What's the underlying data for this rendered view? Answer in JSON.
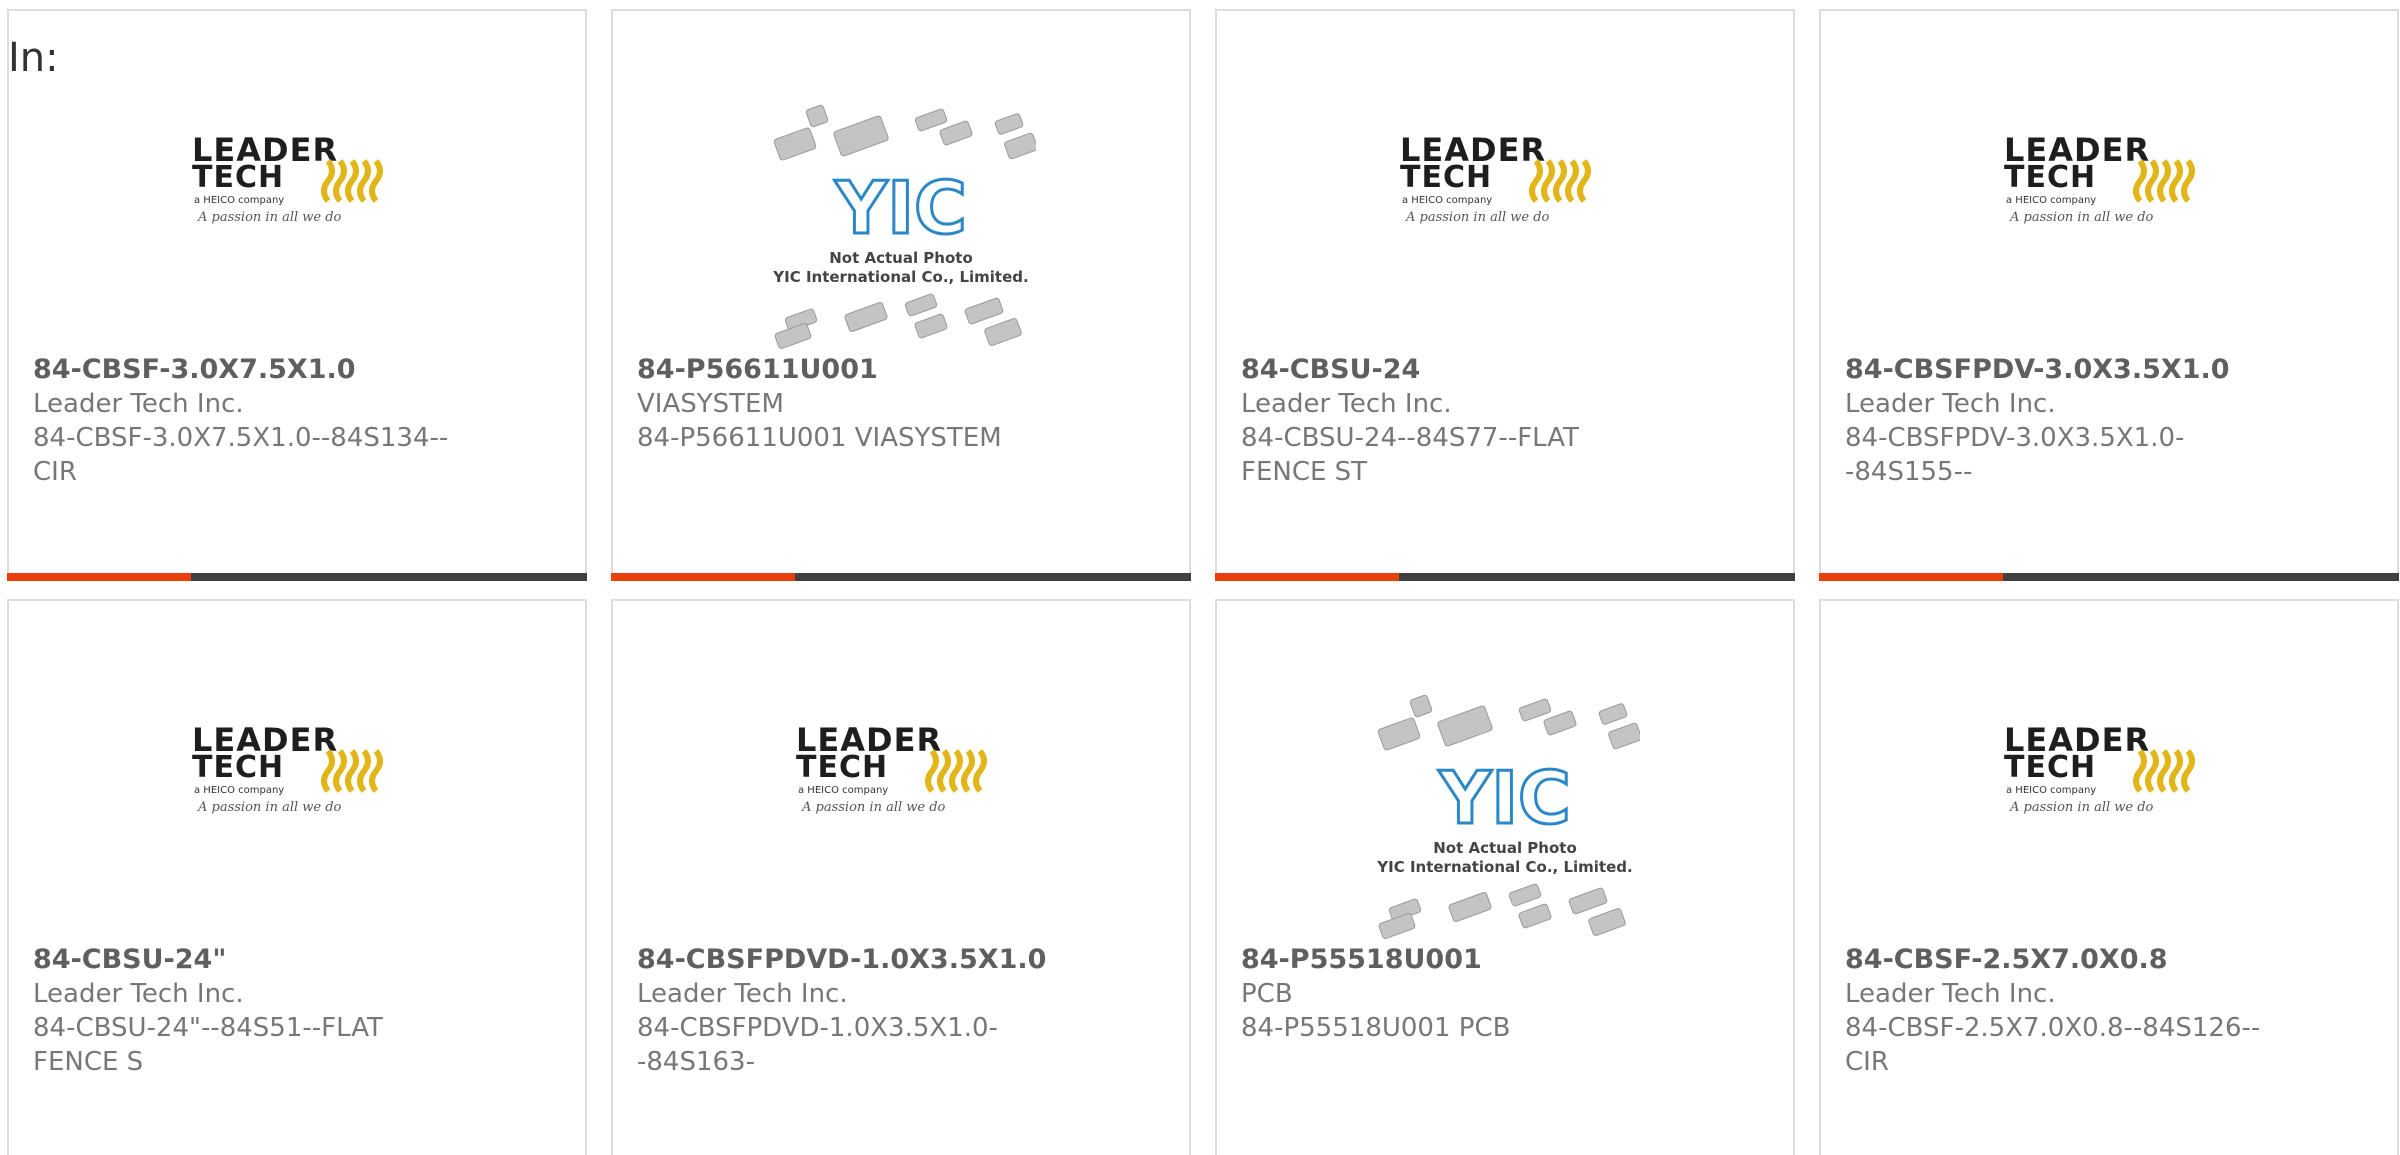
{
  "header": {
    "label": "In:"
  },
  "logos": {
    "leader": {
      "line1": "LEADER",
      "line2": "TECH",
      "tagline": "a HEICO company",
      "slogan": "A passion in all we do"
    },
    "yic": {
      "mark": "YIC",
      "note1": "Not Actual Photo",
      "note2": "YIC International Co., Limited."
    }
  },
  "colors": {
    "accent": "#e8400c",
    "bar": "#404040",
    "leader_gold": "#e2b619",
    "yic_blue": "#2b88c8"
  },
  "products": [
    {
      "part": "84-CBSF-3.0X7.5X1.0",
      "maker": "Leader Tech Inc.",
      "desc": "84-CBSF-3.0X7.5X1.0--84S134--CIR",
      "image": "leader"
    },
    {
      "part": "84-P56611U001",
      "maker": "VIASYSTEM",
      "desc": "84-P56611U001 VIASYSTEM",
      "image": "yic"
    },
    {
      "part": "84-CBSU-24",
      "maker": "Leader Tech Inc.",
      "desc": "84-CBSU-24--84S77--FLAT FENCE ST",
      "image": "leader"
    },
    {
      "part": "84-CBSFPDV-3.0X3.5X1.0",
      "maker": "Leader Tech Inc.",
      "desc": "84-CBSFPDV-3.0X3.5X1.0--84S155--",
      "image": "leader"
    },
    {
      "part": "84-CBSU-24\"",
      "maker": "Leader Tech Inc.",
      "desc": "84-CBSU-24\"--84S51--FLAT FENCE S",
      "image": "leader"
    },
    {
      "part": "84-CBSFPDVD-1.0X3.5X1.0",
      "maker": "Leader Tech Inc.",
      "desc": "84-CBSFPDVD-1.0X3.5X1.0--84S163-",
      "image": "leader"
    },
    {
      "part": "84-P55518U001",
      "maker": "PCB",
      "desc": "84-P55518U001 PCB",
      "image": "yic"
    },
    {
      "part": "84-CBSF-2.5X7.0X0.8",
      "maker": "Leader Tech Inc.",
      "desc": "84-CBSF-2.5X7.0X0.8--84S126--CIR",
      "image": "leader"
    }
  ]
}
